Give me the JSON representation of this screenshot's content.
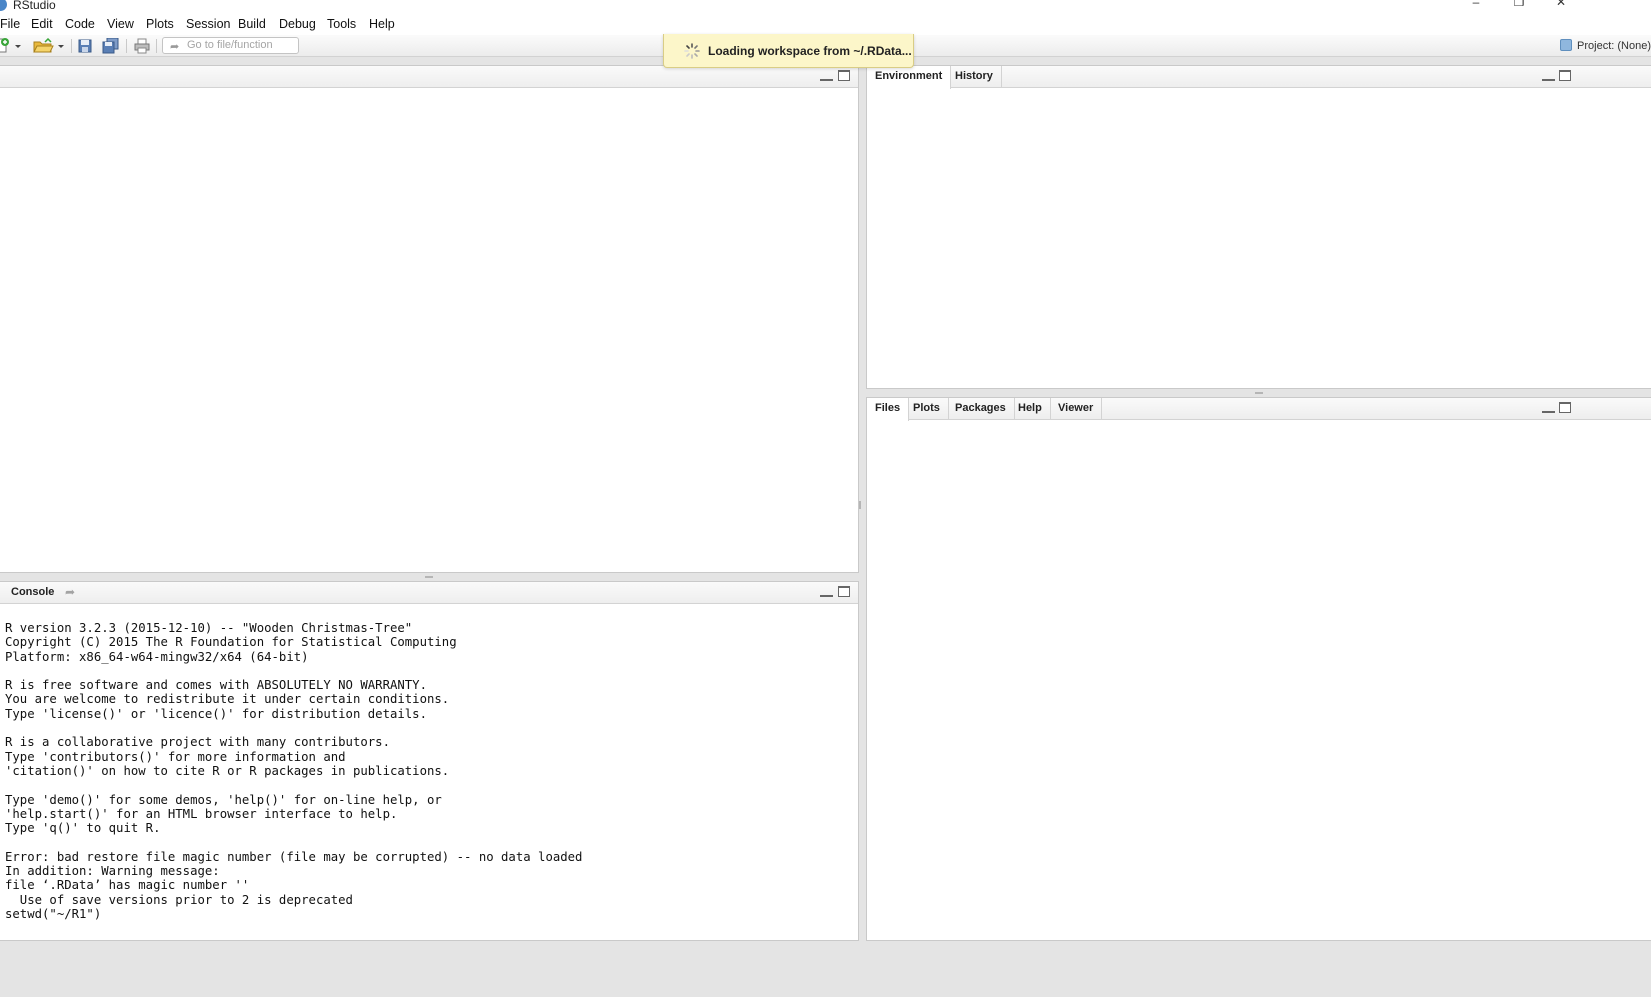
{
  "window": {
    "title": "RStudio",
    "controls": {
      "minimize": "–",
      "restore": "❒",
      "close": "✕"
    }
  },
  "menu": [
    "File",
    "Edit",
    "Code",
    "View",
    "Plots",
    "Session",
    "Build",
    "Debug",
    "Tools",
    "Help"
  ],
  "toolbar": {
    "goto_placeholder": "Go to file/function",
    "project_label": "Project: (None)",
    "icons": [
      "new-file-icon",
      "open-file-icon",
      "save-icon",
      "save-all-icon",
      "print-icon"
    ]
  },
  "toast": {
    "text": "Loading workspace from ~/.RData..."
  },
  "top_right_pane": {
    "tabs": [
      "Environment",
      "History"
    ],
    "active_tab": "Environment"
  },
  "bottom_right_pane": {
    "tabs": [
      "Files",
      "Plots",
      "Packages",
      "Help",
      "Viewer"
    ],
    "active_tab": "Files"
  },
  "console": {
    "tab_label": "Console",
    "lines": [
      "R version 3.2.3 (2015-12-10) -- \"Wooden Christmas-Tree\"",
      "Copyright (C) 2015 The R Foundation for Statistical Computing",
      "Platform: x86_64-w64-mingw32/x64 (64-bit)",
      "",
      "R is free software and comes with ABSOLUTELY NO WARRANTY.",
      "You are welcome to redistribute it under certain conditions.",
      "Type 'license()' or 'licence()' for distribution details.",
      "",
      "R is a collaborative project with many contributors.",
      "Type 'contributors()' for more information and",
      "'citation()' on how to cite R or R packages in publications.",
      "",
      "Type 'demo()' for some demos, 'help()' for on-line help, or",
      "'help.start()' for an HTML browser interface to help.",
      "Type 'q()' to quit R.",
      "",
      "Error: bad restore file magic number (file may be corrupted) -- no data loaded",
      "In addition: Warning message:",
      "file ‘.RData’ has magic number ''",
      "  Use of save versions prior to 2 is deprecated",
      "setwd(\"~/R1\")"
    ]
  }
}
